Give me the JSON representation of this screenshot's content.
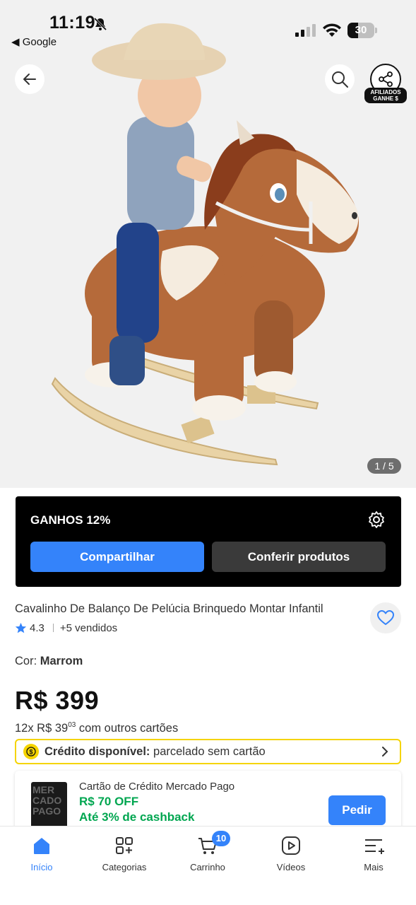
{
  "status_bar": {
    "time": "11:19",
    "back_app": "◀ Google",
    "battery": "30"
  },
  "hero": {
    "image_counter": "1 / 5"
  },
  "affiliate": {
    "badge_line1": "AFILIADOS",
    "badge_line2": "GANHE $",
    "title": "GANHOS 12%",
    "share_label": "Compartilhar",
    "check_label": "Conferir produtos"
  },
  "product": {
    "title": "Cavalinho De Balanço De Pelúcia Brinquedo Montar Infantil",
    "rating": "4.3",
    "sold": "+5 vendidos",
    "color_label": "Cor:",
    "color_value": "Marrom",
    "price": "R$ 399",
    "installments_prefix": "12x R$ 39",
    "installments_cents": "03",
    "installments_suffix": " com outros cartões"
  },
  "credit": {
    "label": "Crédito disponível:",
    "text": " parcelado sem cartão"
  },
  "mp_card": {
    "title": "Cartão de Crédito Mercado Pago",
    "off": "R$ 70 OFF",
    "cashback": "Até 3% de cashback",
    "button": "Pedir",
    "thumb_text": "MER CADO PAGO"
  },
  "nav": {
    "items": [
      {
        "label": "Início",
        "icon": "home-icon"
      },
      {
        "label": "Categorias",
        "icon": "categories-icon"
      },
      {
        "label": "Carrinho",
        "icon": "cart-icon"
      },
      {
        "label": "Vídeos",
        "icon": "video-icon"
      },
      {
        "label": "Mais",
        "icon": "more-icon"
      }
    ],
    "cart_count": "10"
  },
  "colors": {
    "accent": "#3483fa",
    "green": "#00a650",
    "yellow": "#f5d400",
    "hero_bg": "#f1f1f1"
  }
}
